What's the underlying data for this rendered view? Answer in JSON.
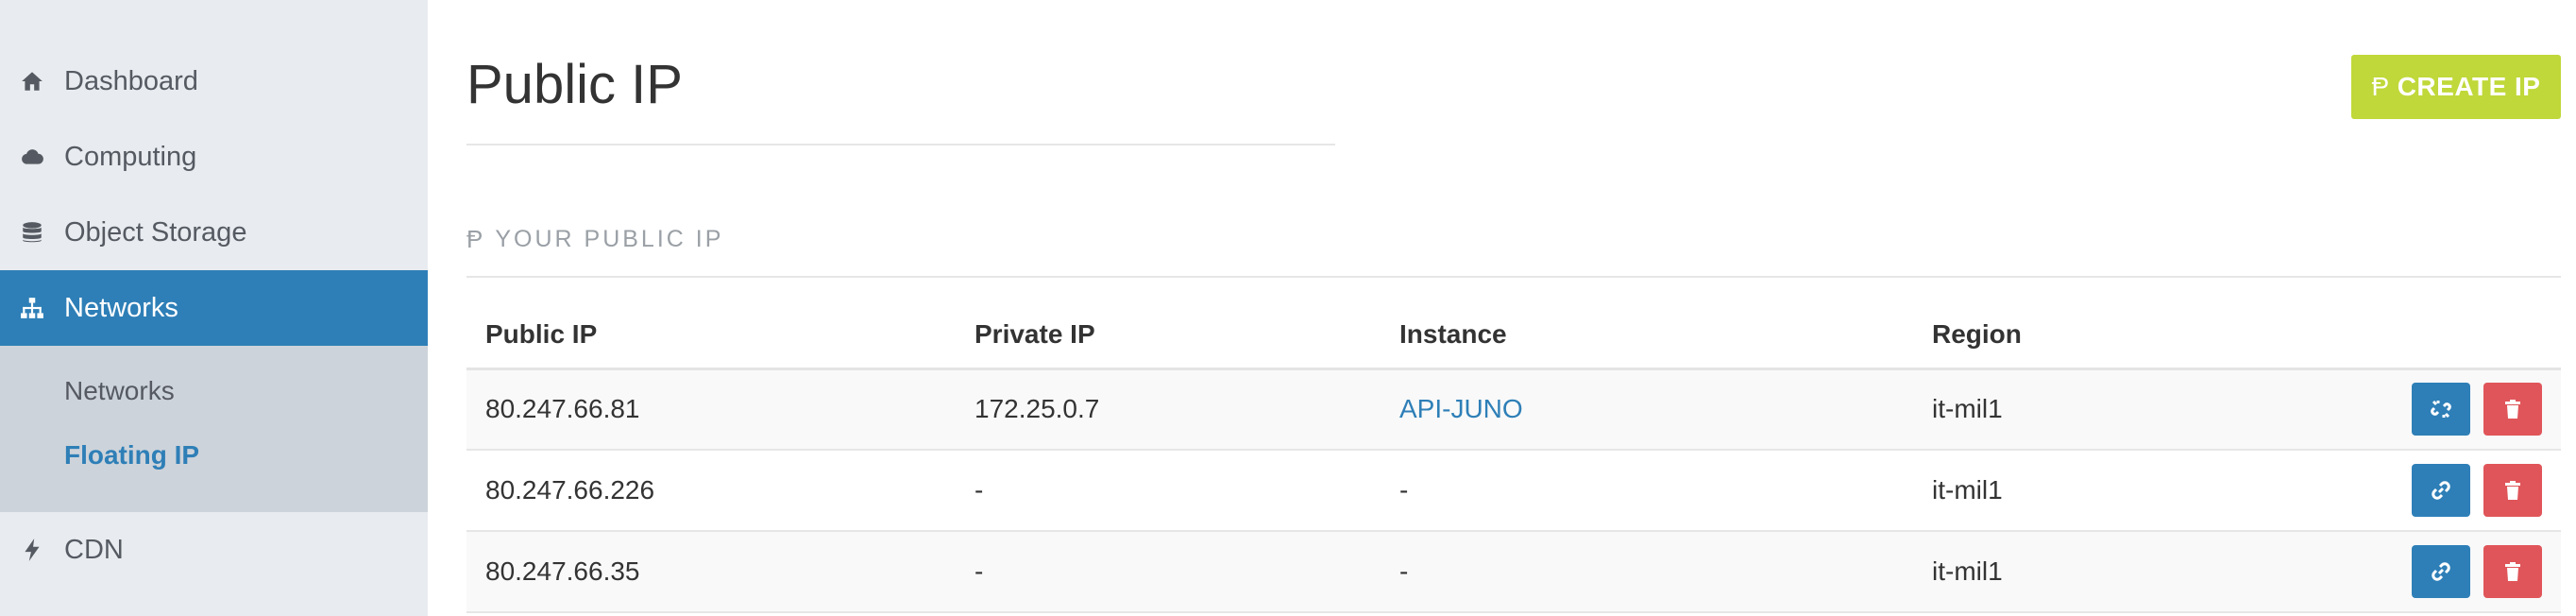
{
  "sidebar": {
    "items": [
      {
        "label": "Dashboard",
        "icon": "home-icon"
      },
      {
        "label": "Computing",
        "icon": "cloud-icon"
      },
      {
        "label": "Object Storage",
        "icon": "database-icon"
      },
      {
        "label": "Networks",
        "icon": "sitemap-icon",
        "active": true
      },
      {
        "label": "CDN",
        "icon": "bolt-icon"
      }
    ],
    "subitems": [
      {
        "label": "Networks"
      },
      {
        "label": "Floating IP",
        "active": true
      }
    ]
  },
  "main": {
    "title": "Public IP",
    "create_button": "CREATE IP",
    "section_title": "YOUR PUBLIC IP",
    "columns": [
      "Public IP",
      "Private IP",
      "Instance",
      "Region"
    ],
    "rows": [
      {
        "public_ip": "80.247.66.81",
        "private_ip": "172.25.0.7",
        "instance": "API-JUNO",
        "region": "it-mil1",
        "attached": true
      },
      {
        "public_ip": "80.247.66.226",
        "private_ip": "-",
        "instance": "-",
        "region": "it-mil1",
        "attached": false
      },
      {
        "public_ip": "80.247.66.35",
        "private_ip": "-",
        "instance": "-",
        "region": "it-mil1",
        "attached": false
      }
    ]
  },
  "colors": {
    "accent": "#2e7fb7",
    "create": "#c0d839",
    "danger": "#e05559"
  }
}
